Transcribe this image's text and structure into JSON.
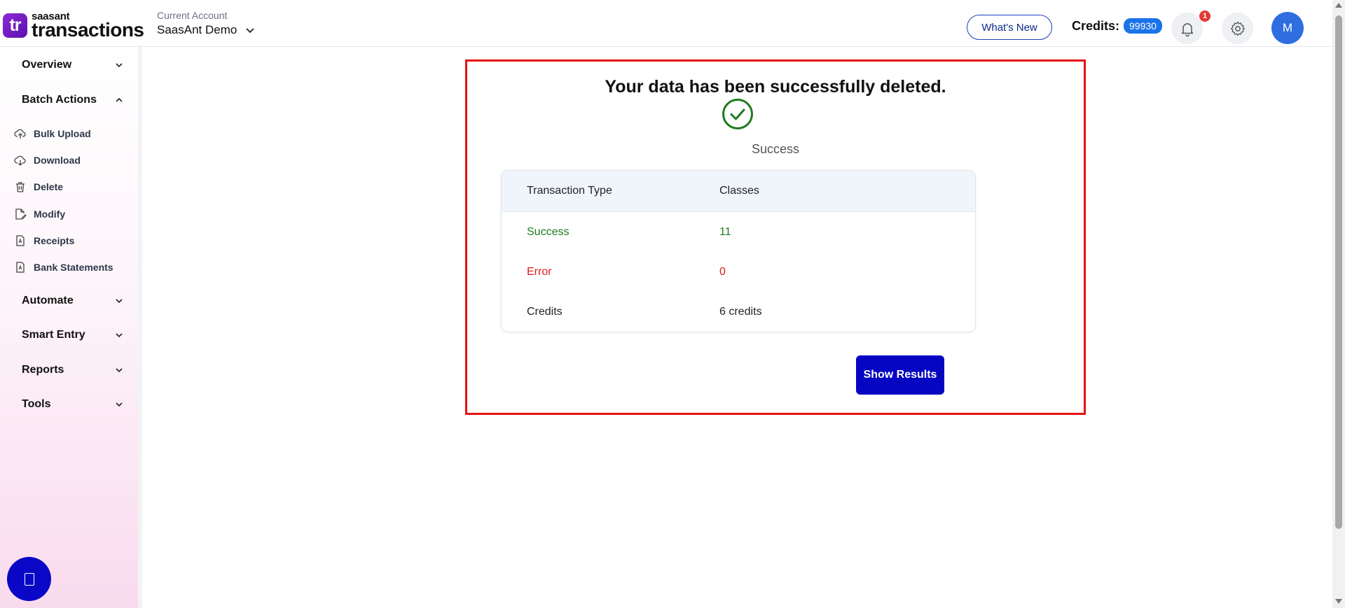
{
  "app": {
    "logo_mark": "tr",
    "logo_small": "saasant",
    "logo_big": "transactions"
  },
  "header": {
    "account_label": "Current Account",
    "account_name": "SaasAnt Demo",
    "whats_new_label": "What's New",
    "credits_label": "Credits:",
    "credits_value": "99930",
    "notification_count": "1",
    "avatar_initial": "M"
  },
  "sidebar": {
    "sections": [
      {
        "label": "Overview",
        "expanded": false
      },
      {
        "label": "Batch Actions",
        "expanded": true
      },
      {
        "label": "Automate",
        "expanded": false
      },
      {
        "label": "Smart Entry",
        "expanded": false
      },
      {
        "label": "Reports",
        "expanded": false
      },
      {
        "label": "Tools",
        "expanded": false
      }
    ],
    "batch_items": [
      {
        "label": "Bulk Upload",
        "icon": "cloud-upload-icon"
      },
      {
        "label": "Download",
        "icon": "cloud-download-icon"
      },
      {
        "label": "Delete",
        "icon": "trash-icon"
      },
      {
        "label": "Modify",
        "icon": "edit-file-icon"
      },
      {
        "label": "Receipts",
        "icon": "pdf-file-icon"
      },
      {
        "label": "Bank Statements",
        "icon": "pdf-file-icon"
      }
    ]
  },
  "result": {
    "title": "Your data has been successfully deleted.",
    "status_caption": "Success",
    "table": {
      "headers": [
        "Transaction Type",
        "Classes"
      ],
      "rows": [
        {
          "label": "Success",
          "value": "11"
        },
        {
          "label": "Error",
          "value": "0"
        },
        {
          "label": "Credits",
          "value": "6 credits"
        }
      ]
    },
    "show_results_label": "Show Results"
  },
  "colors": {
    "accent_blue": "#0505c2",
    "success_green": "#1f7a1f",
    "error_red": "#e01b1b",
    "highlight_border": "#e51212",
    "credits_badge": "#1a73e8"
  }
}
